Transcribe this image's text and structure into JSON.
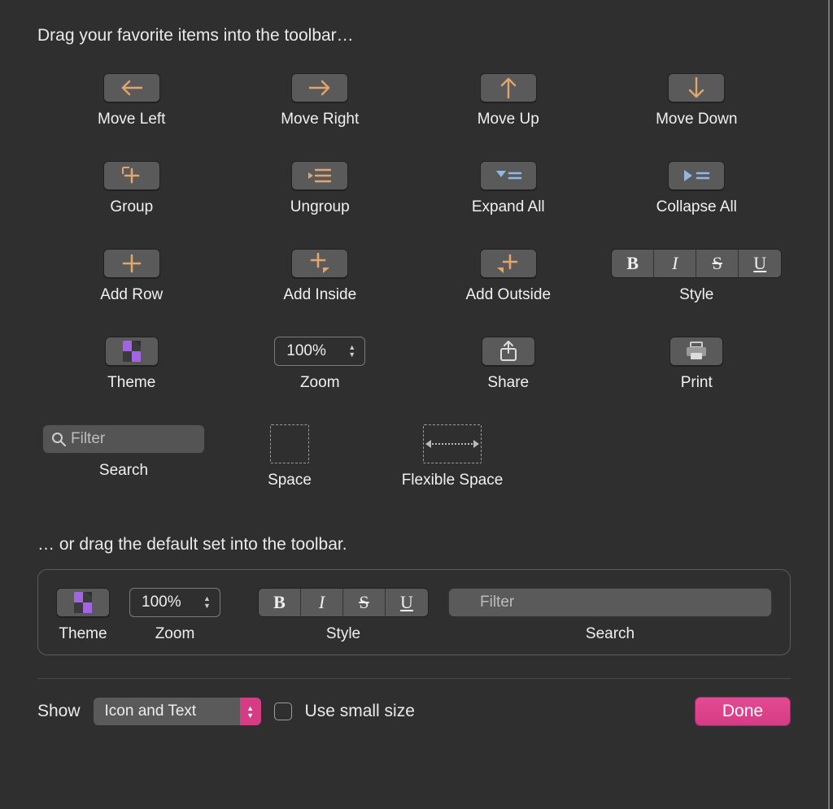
{
  "instructions": {
    "drag_items": "Drag your favorite items into the toolbar…",
    "drag_default": "… or drag the default set into the toolbar."
  },
  "items": {
    "move_left": {
      "label": "Move Left"
    },
    "move_right": {
      "label": "Move Right"
    },
    "move_up": {
      "label": "Move Up"
    },
    "move_down": {
      "label": "Move Down"
    },
    "group": {
      "label": "Group"
    },
    "ungroup": {
      "label": "Ungroup"
    },
    "expand_all": {
      "label": "Expand All"
    },
    "collapse_all": {
      "label": "Collapse All"
    },
    "add_row": {
      "label": "Add Row"
    },
    "add_inside": {
      "label": "Add Inside"
    },
    "add_outside": {
      "label": "Add Outside"
    },
    "style": {
      "label": "Style",
      "segments": {
        "b": "B",
        "i": "I",
        "s": "S",
        "u": "U"
      }
    },
    "theme": {
      "label": "Theme"
    },
    "zoom": {
      "label": "Zoom",
      "value": "100%"
    },
    "share": {
      "label": "Share"
    },
    "print": {
      "label": "Print"
    },
    "search": {
      "label": "Search",
      "placeholder": "Filter"
    },
    "space": {
      "label": "Space"
    },
    "flex_space": {
      "label": "Flexible Space"
    }
  },
  "default_set": {
    "theme": {
      "label": "Theme"
    },
    "zoom": {
      "label": "Zoom",
      "value": "100%"
    },
    "style": {
      "label": "Style",
      "segments": {
        "b": "B",
        "i": "I",
        "s": "S",
        "u": "U"
      }
    },
    "search": {
      "label": "Search",
      "placeholder": "Filter"
    }
  },
  "footer": {
    "show_label": "Show",
    "show_value": "Icon and Text",
    "small_size_label": "Use small size",
    "done_label": "Done"
  }
}
